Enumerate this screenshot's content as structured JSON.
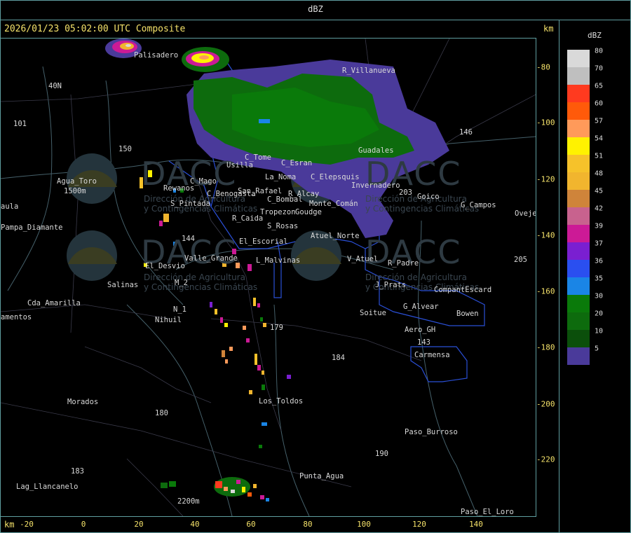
{
  "window": {
    "title": "dBZ"
  },
  "header": {
    "title": "2026/01/23 05:02:00 UTC Composite",
    "unit": "km"
  },
  "axes": {
    "x_unit": "km",
    "x_ticks": [
      "-20",
      "0",
      "20",
      "40",
      "60",
      "80",
      "100",
      "120",
      "140"
    ],
    "y_ticks": [
      "-80",
      "-100",
      "-120",
      "-140",
      "-160",
      "-180",
      "-200",
      "-220"
    ]
  },
  "legend": {
    "title": "dBZ",
    "items": [
      {
        "label": "80",
        "color": "#d9d9d9"
      },
      {
        "label": "70",
        "color": "#bfbfbf"
      },
      {
        "label": "65",
        "color": "#ff3a1f"
      },
      {
        "label": "60",
        "color": "#ff5a0a"
      },
      {
        "label": "57",
        "color": "#ff9a5a"
      },
      {
        "label": "54",
        "color": "#fff200"
      },
      {
        "label": "51",
        "color": "#f6c22a"
      },
      {
        "label": "48",
        "color": "#f1b52e"
      },
      {
        "label": "45",
        "color": "#cf843a"
      },
      {
        "label": "42",
        "color": "#c8628e"
      },
      {
        "label": "39",
        "color": "#cc1a96"
      },
      {
        "label": "37",
        "color": "#7a1fd1"
      },
      {
        "label": "36",
        "color": "#2a4ff0"
      },
      {
        "label": "35",
        "color": "#1a85e6"
      },
      {
        "label": "30",
        "color": "#0a7a0a"
      },
      {
        "label": "20",
        "color": "#0d6b0d"
      },
      {
        "label": "10",
        "color": "#0b4f0b"
      },
      {
        "label": "5",
        "color": "#4a3a9a"
      }
    ]
  },
  "watermark": {
    "brand": "DACC",
    "line1": "Dirección de Agricultura",
    "line2": "y Contingencias Climáticas"
  },
  "places": [
    "Palisadero",
    "R_Villanueva",
    "Guadales",
    "Usilla",
    "C_Tome",
    "C_Esran",
    "C_Elepsquis",
    "Invernadero",
    "San_Rafael",
    "C_Benogasta",
    "C_Bombal",
    "R_Alcay",
    "Goudge",
    "Monte_Comán",
    "Agua_Toro",
    "Rewanos",
    "C_Mago",
    "S_Pintada",
    "R_Caida",
    "S_Rosas",
    "Tropezon",
    "Atuel_Norte",
    "El_Escorial",
    "Valle_Grande",
    "L_Malvinas",
    "V_Atuel",
    "R_Padre",
    "J_Prats",
    "CompantEscard",
    "G_Alvear",
    "Bowen",
    "Soitue",
    "Aero_GH",
    "Carmensa",
    "El_Desvio",
    "Salinas",
    "M_2",
    "N_1",
    "Nihuil",
    "Cda_Amarilla",
    "amentos",
    "Pampa_Diamante",
    "aula",
    "Morados",
    "Los_Toldos",
    "Paso_Burroso",
    "Punta_Agua",
    "Lag_Llancanelo",
    "Paso_El_Loro",
    "G_Campos",
    "Goico",
    "Oveje",
    "40N",
    "101",
    "150",
    "144",
    "179",
    "184",
    "180",
    "183",
    "190",
    "203",
    "205",
    "146",
    "143",
    "1500m",
    "2200m",
    "La_Noma"
  ]
}
